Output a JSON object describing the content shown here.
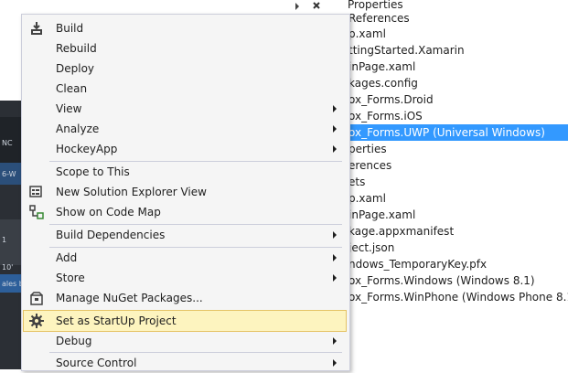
{
  "background_app": {
    "fragments": [
      "NC",
      "6-W",
      "1",
      "10'",
      "ales by"
    ]
  },
  "solution_explorer": {
    "rows": [
      {
        "label": "Properties"
      },
      {
        "label": "References"
      },
      {
        "label": "p.xaml"
      },
      {
        "label": "ttingStarted.Xamarin"
      },
      {
        "label": "inPage.xaml"
      },
      {
        "label": "kages.config"
      },
      {
        "label": "ox_Forms.Droid"
      },
      {
        "label": "ox_Forms.iOS"
      },
      {
        "label": "ox_Forms.UWP (Universal Windows)",
        "selected": true
      },
      {
        "label": "perties"
      },
      {
        "label": "erences"
      },
      {
        "label": "ets"
      },
      {
        "label": "p.xaml"
      },
      {
        "label": "inPage.xaml"
      },
      {
        "label": "kage.appxmanifest"
      },
      {
        "label": "ject.json"
      },
      {
        "label": "ndows_TemporaryKey.pfx"
      },
      {
        "label": "ox_Forms.Windows (Windows 8.1)"
      },
      {
        "label": "ox_Forms.WinPhone (Windows Phone 8.1)"
      }
    ]
  },
  "context_menu": {
    "build": "Build",
    "rebuild": "Rebuild",
    "deploy": "Deploy",
    "clean": "Clean",
    "view": "View",
    "analyze": "Analyze",
    "hockeyapp": "HockeyApp",
    "scope_to_this": "Scope to This",
    "new_se_view": "New Solution Explorer View",
    "show_code_map": "Show on Code Map",
    "build_dependencies": "Build Dependencies",
    "add": "Add",
    "store": "Store",
    "manage_nuget": "Manage NuGet Packages...",
    "set_startup": "Set as StartUp Project",
    "debug": "Debug",
    "source_control": "Source Control"
  },
  "colors": {
    "selection": "#3399ff",
    "menu_bg": "#f5f5f5",
    "highlight_bg": "#fdf4bf",
    "highlight_border": "#e5c365"
  },
  "icons": {
    "build": "build-icon",
    "new_se_view": "solution-explorer-view-icon",
    "code_map": "code-map-icon",
    "nuget": "nuget-package-icon",
    "startup": "gear-icon"
  }
}
